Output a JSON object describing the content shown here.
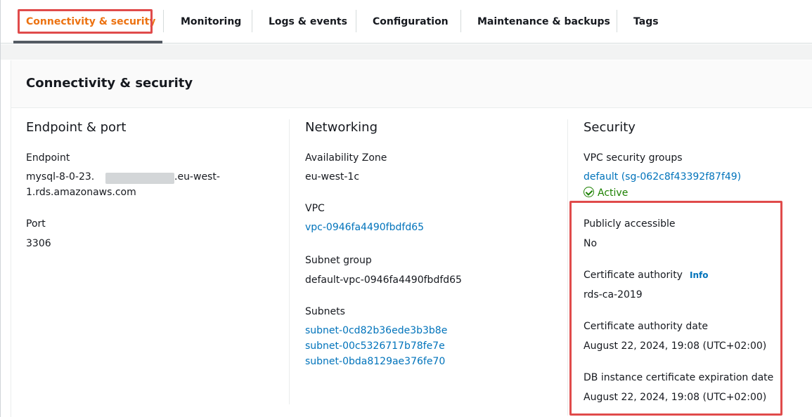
{
  "tabs": [
    {
      "label": "Connectivity & security",
      "active": true
    },
    {
      "label": "Monitoring"
    },
    {
      "label": "Logs & events"
    },
    {
      "label": "Configuration"
    },
    {
      "label": "Maintenance & backups"
    },
    {
      "label": "Tags"
    }
  ],
  "panel": {
    "title": "Connectivity & security"
  },
  "endpoint_port": {
    "title": "Endpoint & port",
    "endpoint_label": "Endpoint",
    "endpoint_prefix": "mysql-8-0-23.",
    "endpoint_suffix": ".eu-west-",
    "endpoint_line2": "1.rds.amazonaws.com",
    "port_label": "Port",
    "port_value": "3306"
  },
  "networking": {
    "title": "Networking",
    "az_label": "Availability Zone",
    "az_value": "eu-west-1c",
    "vpc_label": "VPC",
    "vpc_value": "vpc-0946fa4490fbdfd65",
    "subnet_group_label": "Subnet group",
    "subnet_group_value": "default-vpc-0946fa4490fbdfd65",
    "subnets_label": "Subnets",
    "subnets": [
      "subnet-0cd82b36ede3b3b8e",
      "subnet-00c5326717b78fe7e",
      "subnet-0bda8129ae376fe70"
    ]
  },
  "security": {
    "title": "Security",
    "sg_label": "VPC security groups",
    "sg_value": "default (sg-062c8f43392f87f49)",
    "sg_status": "Active",
    "public_label": "Publicly accessible",
    "public_value": "No",
    "ca_label": "Certificate authority",
    "ca_info": "Info",
    "ca_value": "rds-ca-2019",
    "ca_date_label": "Certificate authority date",
    "ca_date_value": "August 22, 2024, 19:08 (UTC+02:00)",
    "cert_exp_label": "DB instance certificate expiration date",
    "cert_exp_value": "August 22, 2024, 19:08 (UTC+02:00)"
  },
  "colors": {
    "active_tab": "#ec7211",
    "link": "#0073bb",
    "status_ok": "#1d8102",
    "highlight": "#e04b4b"
  }
}
